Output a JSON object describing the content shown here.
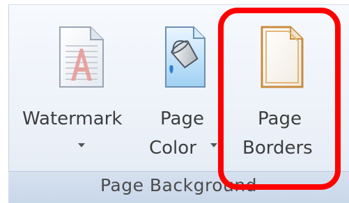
{
  "group": {
    "label": "Page Background"
  },
  "commands": {
    "watermark": {
      "label_line1": "Watermark",
      "icon": "watermark-icon",
      "has_dropdown": true
    },
    "page_color": {
      "label_line1": "Page",
      "label_line2": "Color",
      "icon": "page-color-icon",
      "has_dropdown": true
    },
    "page_borders": {
      "label_line1": "Page",
      "label_line2": "Borders",
      "icon": "page-borders-icon",
      "highlighted": true
    }
  },
  "colors": {
    "highlight": "#ff0000",
    "ribbon_bg": "#edf2f9",
    "footer_bg": "#cfdcec",
    "text": "#3d3d3d"
  }
}
